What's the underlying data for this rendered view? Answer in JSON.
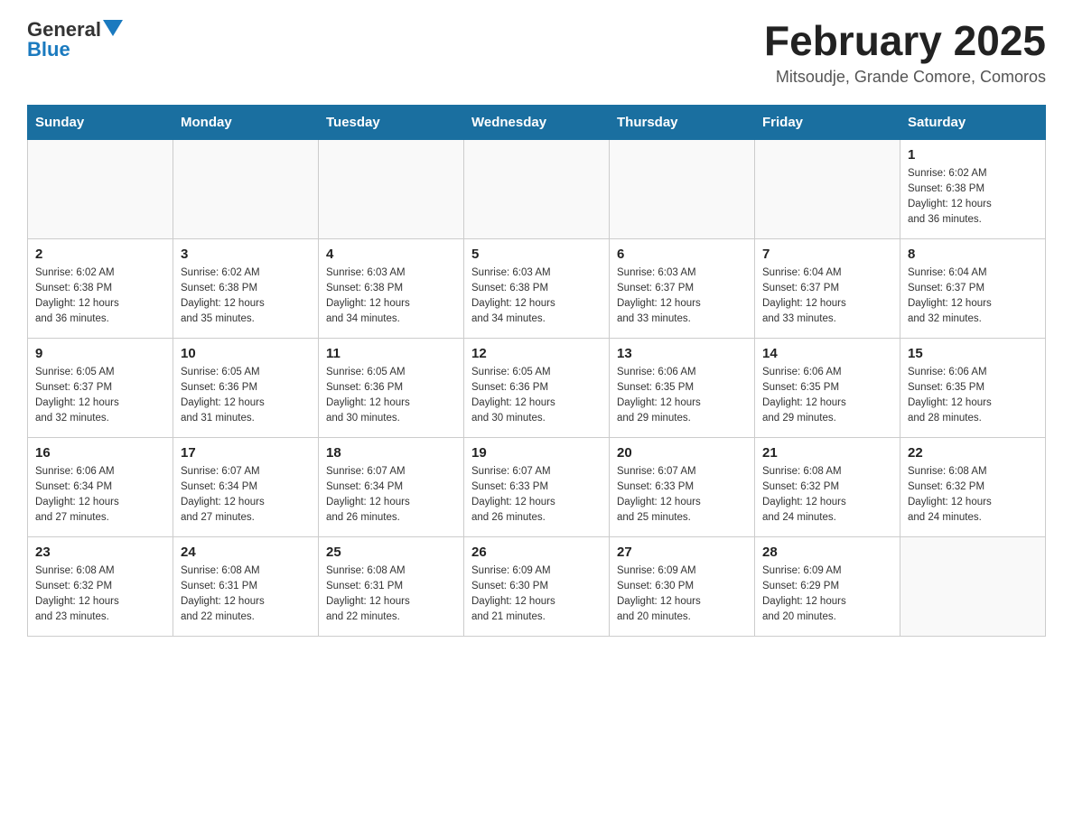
{
  "header": {
    "logo_text_black": "General",
    "logo_text_blue": "Blue",
    "title": "February 2025",
    "subtitle": "Mitsoudje, Grande Comore, Comoros"
  },
  "weekdays": [
    "Sunday",
    "Monday",
    "Tuesday",
    "Wednesday",
    "Thursday",
    "Friday",
    "Saturday"
  ],
  "weeks": [
    [
      {
        "day": "",
        "info": ""
      },
      {
        "day": "",
        "info": ""
      },
      {
        "day": "",
        "info": ""
      },
      {
        "day": "",
        "info": ""
      },
      {
        "day": "",
        "info": ""
      },
      {
        "day": "",
        "info": ""
      },
      {
        "day": "1",
        "info": "Sunrise: 6:02 AM\nSunset: 6:38 PM\nDaylight: 12 hours\nand 36 minutes."
      }
    ],
    [
      {
        "day": "2",
        "info": "Sunrise: 6:02 AM\nSunset: 6:38 PM\nDaylight: 12 hours\nand 36 minutes."
      },
      {
        "day": "3",
        "info": "Sunrise: 6:02 AM\nSunset: 6:38 PM\nDaylight: 12 hours\nand 35 minutes."
      },
      {
        "day": "4",
        "info": "Sunrise: 6:03 AM\nSunset: 6:38 PM\nDaylight: 12 hours\nand 34 minutes."
      },
      {
        "day": "5",
        "info": "Sunrise: 6:03 AM\nSunset: 6:38 PM\nDaylight: 12 hours\nand 34 minutes."
      },
      {
        "day": "6",
        "info": "Sunrise: 6:03 AM\nSunset: 6:37 PM\nDaylight: 12 hours\nand 33 minutes."
      },
      {
        "day": "7",
        "info": "Sunrise: 6:04 AM\nSunset: 6:37 PM\nDaylight: 12 hours\nand 33 minutes."
      },
      {
        "day": "8",
        "info": "Sunrise: 6:04 AM\nSunset: 6:37 PM\nDaylight: 12 hours\nand 32 minutes."
      }
    ],
    [
      {
        "day": "9",
        "info": "Sunrise: 6:05 AM\nSunset: 6:37 PM\nDaylight: 12 hours\nand 32 minutes."
      },
      {
        "day": "10",
        "info": "Sunrise: 6:05 AM\nSunset: 6:36 PM\nDaylight: 12 hours\nand 31 minutes."
      },
      {
        "day": "11",
        "info": "Sunrise: 6:05 AM\nSunset: 6:36 PM\nDaylight: 12 hours\nand 30 minutes."
      },
      {
        "day": "12",
        "info": "Sunrise: 6:05 AM\nSunset: 6:36 PM\nDaylight: 12 hours\nand 30 minutes."
      },
      {
        "day": "13",
        "info": "Sunrise: 6:06 AM\nSunset: 6:35 PM\nDaylight: 12 hours\nand 29 minutes."
      },
      {
        "day": "14",
        "info": "Sunrise: 6:06 AM\nSunset: 6:35 PM\nDaylight: 12 hours\nand 29 minutes."
      },
      {
        "day": "15",
        "info": "Sunrise: 6:06 AM\nSunset: 6:35 PM\nDaylight: 12 hours\nand 28 minutes."
      }
    ],
    [
      {
        "day": "16",
        "info": "Sunrise: 6:06 AM\nSunset: 6:34 PM\nDaylight: 12 hours\nand 27 minutes."
      },
      {
        "day": "17",
        "info": "Sunrise: 6:07 AM\nSunset: 6:34 PM\nDaylight: 12 hours\nand 27 minutes."
      },
      {
        "day": "18",
        "info": "Sunrise: 6:07 AM\nSunset: 6:34 PM\nDaylight: 12 hours\nand 26 minutes."
      },
      {
        "day": "19",
        "info": "Sunrise: 6:07 AM\nSunset: 6:33 PM\nDaylight: 12 hours\nand 26 minutes."
      },
      {
        "day": "20",
        "info": "Sunrise: 6:07 AM\nSunset: 6:33 PM\nDaylight: 12 hours\nand 25 minutes."
      },
      {
        "day": "21",
        "info": "Sunrise: 6:08 AM\nSunset: 6:32 PM\nDaylight: 12 hours\nand 24 minutes."
      },
      {
        "day": "22",
        "info": "Sunrise: 6:08 AM\nSunset: 6:32 PM\nDaylight: 12 hours\nand 24 minutes."
      }
    ],
    [
      {
        "day": "23",
        "info": "Sunrise: 6:08 AM\nSunset: 6:32 PM\nDaylight: 12 hours\nand 23 minutes."
      },
      {
        "day": "24",
        "info": "Sunrise: 6:08 AM\nSunset: 6:31 PM\nDaylight: 12 hours\nand 22 minutes."
      },
      {
        "day": "25",
        "info": "Sunrise: 6:08 AM\nSunset: 6:31 PM\nDaylight: 12 hours\nand 22 minutes."
      },
      {
        "day": "26",
        "info": "Sunrise: 6:09 AM\nSunset: 6:30 PM\nDaylight: 12 hours\nand 21 minutes."
      },
      {
        "day": "27",
        "info": "Sunrise: 6:09 AM\nSunset: 6:30 PM\nDaylight: 12 hours\nand 20 minutes."
      },
      {
        "day": "28",
        "info": "Sunrise: 6:09 AM\nSunset: 6:29 PM\nDaylight: 12 hours\nand 20 minutes."
      },
      {
        "day": "",
        "info": ""
      }
    ]
  ]
}
